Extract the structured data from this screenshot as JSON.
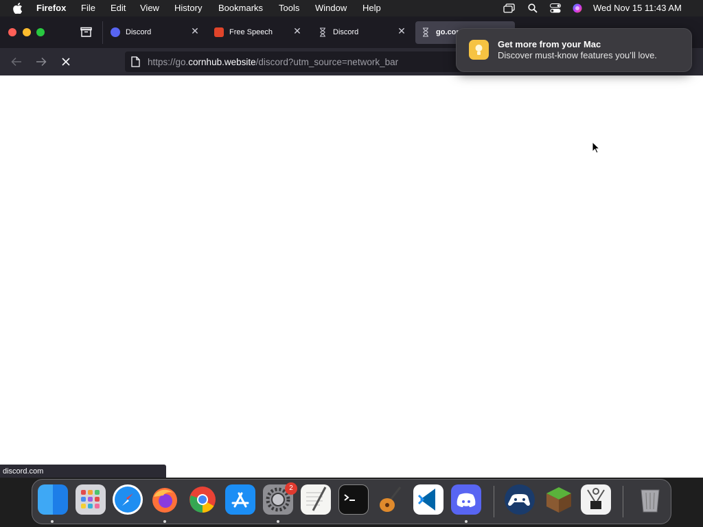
{
  "menubar": {
    "app_name": "Firefox",
    "items": [
      "File",
      "Edit",
      "View",
      "History",
      "Bookmarks",
      "Tools",
      "Window",
      "Help"
    ],
    "clock": "Wed Nov 15  11:43 AM"
  },
  "tabs": [
    {
      "label": "Discord",
      "icon": "discord-icon"
    },
    {
      "label": "Free Speech",
      "icon": "vivaldi-v-icon"
    },
    {
      "label": "Discord",
      "icon": "hourglass-loading-icon"
    },
    {
      "label": "go.cor",
      "icon": "hourglass-loading-icon",
      "active": true
    }
  ],
  "urlbar": {
    "prefix": "https://go.",
    "host": "cornhub.website",
    "path": "/discord?utm_source=network_bar"
  },
  "statusbar": {
    "text": "discord.com"
  },
  "notification": {
    "title": "Get more from your Mac",
    "body": "Discover must-know features you’ll love."
  },
  "dock": {
    "apps": [
      "Finder",
      "Launchpad",
      "Safari",
      "Firefox",
      "Chrome",
      "App Store",
      "System Settings",
      "TextEdit",
      "Terminal",
      "GarageBand",
      "VS Code",
      "Discord",
      "Steam Link",
      "Minecraft",
      "System Information",
      "Trash"
    ],
    "settings_badge": "2"
  },
  "colors": {
    "accent_red": "#ff5f57",
    "accent_yellow": "#febc2e",
    "accent_green": "#28c840",
    "discord_blurple": "#5865f2"
  }
}
